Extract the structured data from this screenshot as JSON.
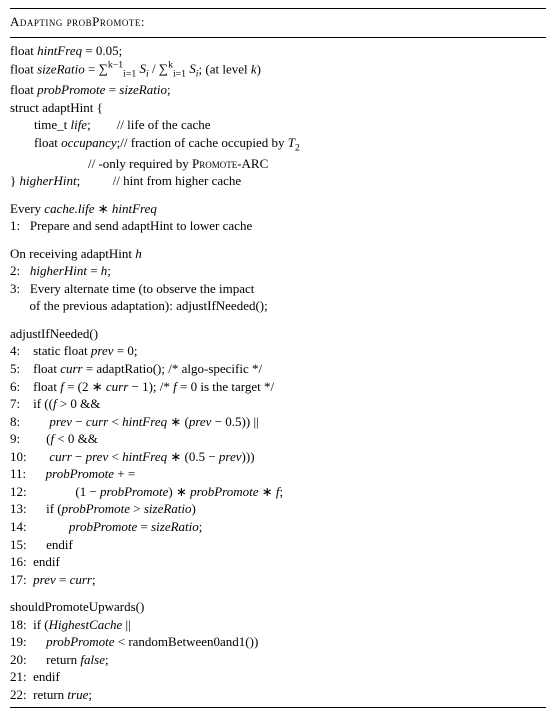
{
  "title": "Adapting probPromote:",
  "decls": {
    "d1a": "float ",
    "d1b": "hintFreq",
    "d1c": " = 0.05;",
    "d2a": "float ",
    "d2b": "sizeRatio",
    "d2c": " = ",
    "d2d": "; (at level ",
    "d2e": "k",
    "d2f": ")",
    "d3a": "float ",
    "d3b": "probPromote",
    "d3c": " = ",
    "d3d": "sizeRatio",
    "d3e": ";",
    "d4": "struct adaptHint {",
    "d5a": "time_t ",
    "d5b": "life",
    "d5c": ";        // life of the cache",
    "d6a": "float ",
    "d6b": "occupancy",
    "d6c": ";// fraction of cache occupied by ",
    "d6d": "T",
    "d7": "                        // -only required by ",
    "d7b": "Promote-ARC",
    "d8a": "} ",
    "d8b": "higherHint",
    "d8c": ";          // hint from higher cache"
  },
  "sec1": {
    "hdr_a": "Every ",
    "hdr_b": "cache.life",
    "hdr_c": " ∗ ",
    "hdr_d": "hintFreq",
    "l1": "1:   Prepare and send adaptHint to lower cache"
  },
  "sec2": {
    "hdr_a": "On receiving adaptHint ",
    "hdr_b": "h",
    "l2a": "2:   ",
    "l2b": "higherHint",
    "l2c": " = ",
    "l2d": "h",
    "l2e": ";",
    "l3": "3:   Every alternate time (to observe the impact",
    "l3b": "      of the previous adaptation): adjustIfNeeded();"
  },
  "sec3": {
    "hdr": "adjustIfNeeded()",
    "l4a": "4:    static float ",
    "l4b": "prev",
    "l4c": " = 0;",
    "l5a": "5:    float ",
    "l5b": "curr",
    "l5c": " = adaptRatio(); /* algo-specific */",
    "l6a": "6:    float ",
    "l6b": "f",
    "l6c": " = (2 ∗ ",
    "l6d": "curr",
    "l6e": " − 1); /* ",
    "l6f": "f",
    "l6g": " = 0 is the target */",
    "l7a": "7:    if ((",
    "l7b": "f",
    "l7c": " > 0 &&",
    "l8a": "8:         ",
    "l8b": "prev",
    "l8c": " − ",
    "l8d": "curr",
    "l8e": " < ",
    "l8f": "hintFreq",
    "l8g": " ∗ (",
    "l8h": "prev",
    "l8i": " − 0.5)) ||",
    "l9a": "9:        (",
    "l9b": "f",
    "l9c": " < 0 &&",
    "l10a": "10:       ",
    "l10b": "curr",
    "l10c": " − ",
    "l10d": "prev",
    "l10e": " < ",
    "l10f": "hintFreq",
    "l10g": " ∗ (0.5 − ",
    "l10h": "prev",
    "l10i": ")))",
    "l11a": "11:      ",
    "l11b": "probPromote",
    "l11c": " + =",
    "l12a": "12:               (1 − ",
    "l12b": "probPromote",
    "l12c": ") ∗ ",
    "l12d": "probPromote",
    "l12e": " ∗ ",
    "l12f": "f",
    "l12g": ";",
    "l13a": "13:      if (",
    "l13b": "probPromote",
    "l13c": " > ",
    "l13d": "sizeRatio",
    "l13e": ")",
    "l14a": "14:             ",
    "l14b": "probPromote",
    "l14c": " = ",
    "l14d": "sizeRatio",
    "l14e": ";",
    "l15": "15:      endif",
    "l16": "16:  endif",
    "l17a": "17:  ",
    "l17b": "prev",
    "l17c": " = ",
    "l17d": "curr",
    "l17e": ";"
  },
  "sec4": {
    "hdr": "shouldPromoteUpwards()",
    "l18a": "18:  if (",
    "l18b": "HighestCache",
    "l18c": " ||",
    "l19a": "19:      ",
    "l19b": "probPromote",
    "l19c": " < randomBetween0and1())",
    "l20a": "20:      return ",
    "l20b": "false",
    "l20c": ";",
    "l21": "21:  endif",
    "l22a": "22:  return ",
    "l22b": "true",
    "l22c": ";"
  }
}
